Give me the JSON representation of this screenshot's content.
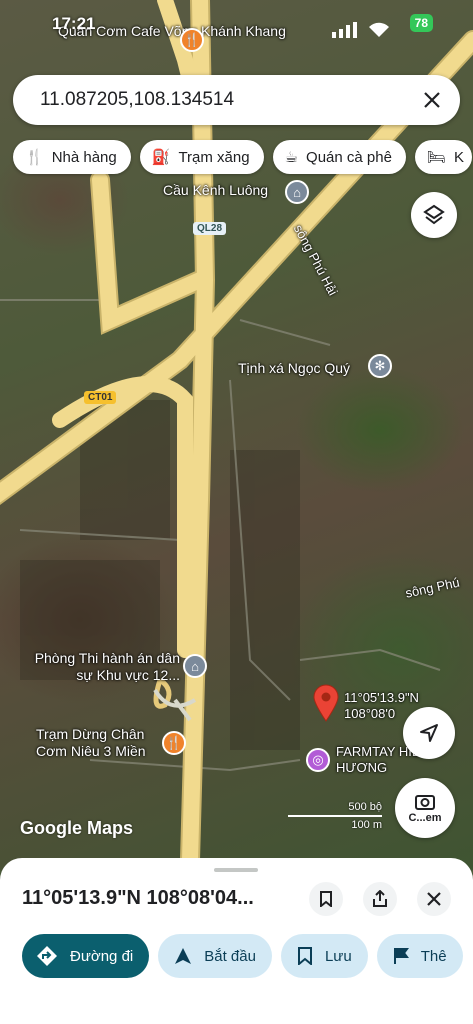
{
  "status": {
    "time": "17:21",
    "battery": "78"
  },
  "search": {
    "value": "11.087205,108.134514"
  },
  "chips": [
    {
      "label": "Nhà hàng",
      "icon": "fork-knife-icon"
    },
    {
      "label": "Trạm xăng",
      "icon": "gas-station-icon"
    },
    {
      "label": "Quán cà phê",
      "icon": "coffee-icon"
    },
    {
      "label": "K",
      "icon": "hotel-bed-icon"
    }
  ],
  "map": {
    "labels": {
      "cafe": "Quán Cơm Cafe Võng Khánh Khang",
      "bridge": "Cầu Kênh Luông",
      "river1": "sông Phú Hải",
      "temple": "Tịnh xá Ngọc Quý",
      "river2": "sông Phú",
      "office": "Phòng Thi hành án dân sự Khu vực 12...",
      "restaurant": "Trạm Dừng Chân Cơm Niêu 3 Miền",
      "pin_coords": "11°05'13.9\"N 108°08'0",
      "farm": "FARMTAY HIỀN HƯƠNG",
      "camera_label": "C...em"
    },
    "shields": {
      "ql28": "QL28",
      "ct01": "CT01"
    },
    "scale": {
      "feet": "500 bộ",
      "meters": "100 m"
    },
    "attribution": "Google Maps"
  },
  "sheet": {
    "title": "11°05'13.9\"N 108°08'04...",
    "actions": [
      {
        "label": "Đường đi",
        "icon": "directions-icon"
      },
      {
        "label": "Bắt đầu",
        "icon": "navigation-arrow-icon"
      },
      {
        "label": "Lưu",
        "icon": "bookmark-icon"
      },
      {
        "label": "Thê",
        "icon": "flag-icon"
      }
    ]
  },
  "colors": {
    "primary": "#0b5f6e",
    "secondary": "#d3e9f5",
    "road": "#f1da8e",
    "pin": "#ea4335"
  }
}
